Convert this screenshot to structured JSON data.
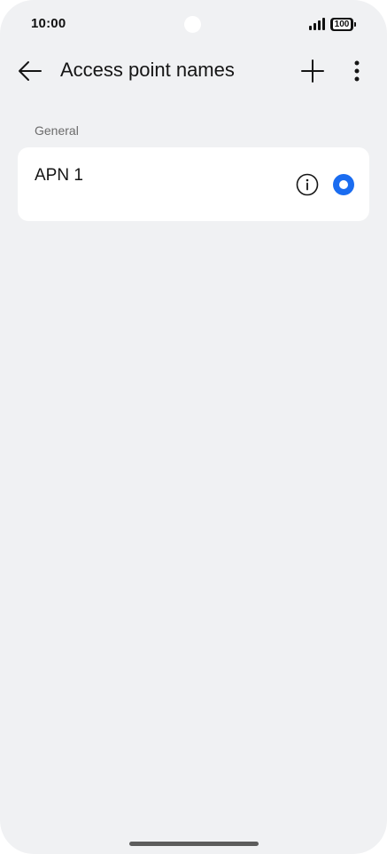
{
  "status_bar": {
    "time": "10:00",
    "battery": "100"
  },
  "toolbar": {
    "title": "Access point names",
    "icons": {
      "back": "arrow-left-icon",
      "add": "plus-icon",
      "more": "more-vertical-icon"
    }
  },
  "sections": [
    {
      "header": "General",
      "items": [
        {
          "name": "APN 1",
          "selected": true,
          "info_icon": "info-icon"
        }
      ]
    }
  ],
  "colors": {
    "accent": "#1a6cf0",
    "background": "#f0f1f3",
    "card": "#ffffff"
  }
}
